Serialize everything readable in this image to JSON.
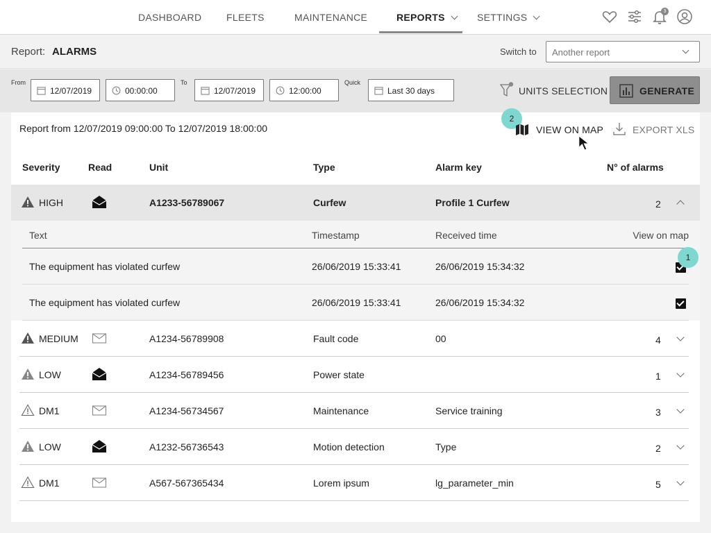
{
  "nav": {
    "items": [
      {
        "label": "DASHBOARD"
      },
      {
        "label": "FLEETS"
      },
      {
        "label": "MAINTENANCE"
      },
      {
        "label": "REPORTS"
      },
      {
        "label": "SETTINGS"
      }
    ],
    "notification_count": "3"
  },
  "report": {
    "label": "Report:",
    "name": "ALARMS",
    "switch_label": "Switch to",
    "switch_placeholder": "Another report"
  },
  "filters": {
    "from_label": "From",
    "from_date": "12/07/2019",
    "from_time": "00:00:00",
    "to_label": "To",
    "to_date": "12/07/2019",
    "to_time": "12:00:00",
    "quick_label": "Quick",
    "quick_value": "Last 30 days",
    "units_label": "UNITS SELECTION",
    "generate_label": "GENERATE"
  },
  "panel": {
    "range_text": "Report from 12/07/2019 09:00:00 To 12/07/2019 18:00:00",
    "view_on_map_label": "VIEW ON MAP",
    "export_label": "EXPORT XLS",
    "badge_view_map": "2",
    "badge_checkbox": "1"
  },
  "table": {
    "headers": {
      "severity": "Severity",
      "read": "Read",
      "unit": "Unit",
      "type": "Type",
      "alarm_key": "Alarm key",
      "count": "N° of alarms"
    },
    "rows": [
      {
        "severity": "HIGH",
        "unit": "A1233-56789067",
        "type": "Curfew",
        "alarm_key": "Profile 1 Curfew",
        "count": "2"
      },
      {
        "severity": "MEDIUM",
        "unit": "A1234-56789908",
        "type": "Fault code",
        "alarm_key": "00",
        "count": "4"
      },
      {
        "severity": "LOW",
        "unit": "A1234-56789456",
        "type": "Power state",
        "alarm_key": "",
        "count": "1"
      },
      {
        "severity": "DM1",
        "unit": "A1234-56734567",
        "type": "Maintenance",
        "alarm_key": "Service training",
        "count": "3"
      },
      {
        "severity": "LOW",
        "unit": "A1232-56736543",
        "type": "Motion detection",
        "alarm_key": "Type",
        "count": "2"
      },
      {
        "severity": "DM1",
        "unit": "A567-567365434",
        "type": "Lorem ipsum",
        "alarm_key": "lg_parameter_min",
        "count": "5"
      }
    ],
    "sub_headers": {
      "text": "Text",
      "timestamp": "Timestamp",
      "received": "Received time",
      "view_on_map": "View on map"
    },
    "sub_rows": [
      {
        "text": "The equipment has violated curfew",
        "timestamp": "26/06/2019 15:33:41",
        "received": "26/06/2019 15:34:32"
      },
      {
        "text": "The equipment has violated curfew",
        "timestamp": "26/06/2019 15:33:41",
        "received": "26/06/2019 15:34:32"
      }
    ]
  }
}
